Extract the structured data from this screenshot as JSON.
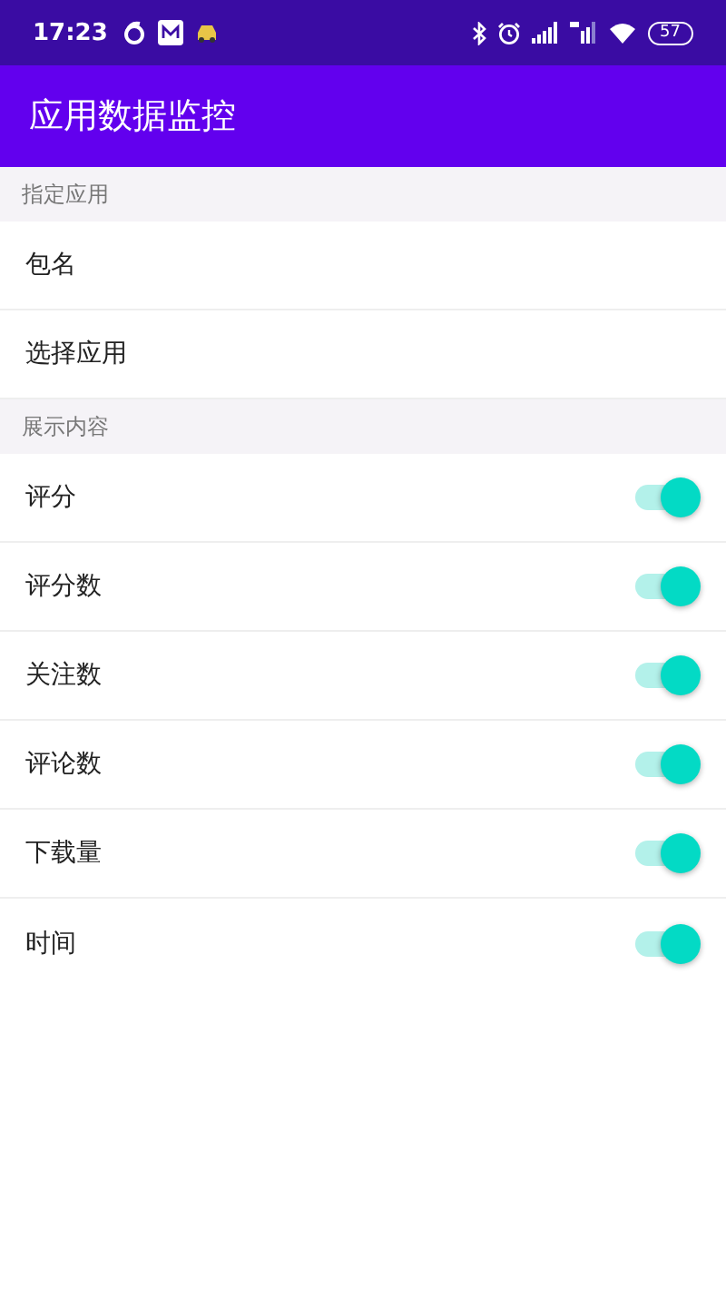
{
  "status_bar": {
    "time": "17:23",
    "battery": "57"
  },
  "app_bar": {
    "title": "应用数据监控"
  },
  "sections": [
    {
      "header": "指定应用",
      "items": [
        {
          "kind": "text",
          "label": "包名"
        },
        {
          "kind": "text",
          "label": "选择应用"
        }
      ]
    },
    {
      "header": "展示内容",
      "items": [
        {
          "kind": "switch",
          "label": "评分",
          "on": true
        },
        {
          "kind": "switch",
          "label": "评分数",
          "on": true
        },
        {
          "kind": "switch",
          "label": "关注数",
          "on": true
        },
        {
          "kind": "switch",
          "label": "评论数",
          "on": true
        },
        {
          "kind": "switch",
          "label": "下载量",
          "on": true
        },
        {
          "kind": "switch",
          "label": "时间",
          "on": true
        }
      ]
    }
  ]
}
